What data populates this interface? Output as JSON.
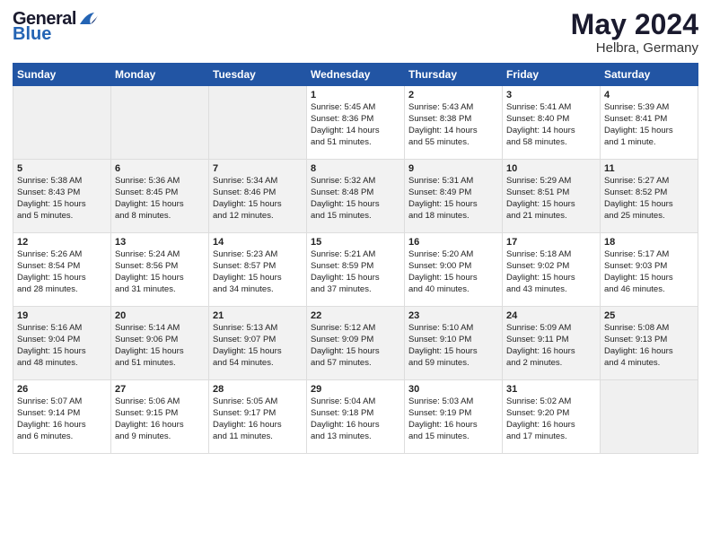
{
  "header": {
    "logo_general": "General",
    "logo_blue": "Blue",
    "month": "May 2024",
    "location": "Helbra, Germany"
  },
  "weekdays": [
    "Sunday",
    "Monday",
    "Tuesday",
    "Wednesday",
    "Thursday",
    "Friday",
    "Saturday"
  ],
  "weeks": [
    [
      {
        "day": "",
        "info": ""
      },
      {
        "day": "",
        "info": ""
      },
      {
        "day": "",
        "info": ""
      },
      {
        "day": "1",
        "info": "Sunrise: 5:45 AM\nSunset: 8:36 PM\nDaylight: 14 hours\nand 51 minutes."
      },
      {
        "day": "2",
        "info": "Sunrise: 5:43 AM\nSunset: 8:38 PM\nDaylight: 14 hours\nand 55 minutes."
      },
      {
        "day": "3",
        "info": "Sunrise: 5:41 AM\nSunset: 8:40 PM\nDaylight: 14 hours\nand 58 minutes."
      },
      {
        "day": "4",
        "info": "Sunrise: 5:39 AM\nSunset: 8:41 PM\nDaylight: 15 hours\nand 1 minute."
      }
    ],
    [
      {
        "day": "5",
        "info": "Sunrise: 5:38 AM\nSunset: 8:43 PM\nDaylight: 15 hours\nand 5 minutes."
      },
      {
        "day": "6",
        "info": "Sunrise: 5:36 AM\nSunset: 8:45 PM\nDaylight: 15 hours\nand 8 minutes."
      },
      {
        "day": "7",
        "info": "Sunrise: 5:34 AM\nSunset: 8:46 PM\nDaylight: 15 hours\nand 12 minutes."
      },
      {
        "day": "8",
        "info": "Sunrise: 5:32 AM\nSunset: 8:48 PM\nDaylight: 15 hours\nand 15 minutes."
      },
      {
        "day": "9",
        "info": "Sunrise: 5:31 AM\nSunset: 8:49 PM\nDaylight: 15 hours\nand 18 minutes."
      },
      {
        "day": "10",
        "info": "Sunrise: 5:29 AM\nSunset: 8:51 PM\nDaylight: 15 hours\nand 21 minutes."
      },
      {
        "day": "11",
        "info": "Sunrise: 5:27 AM\nSunset: 8:52 PM\nDaylight: 15 hours\nand 25 minutes."
      }
    ],
    [
      {
        "day": "12",
        "info": "Sunrise: 5:26 AM\nSunset: 8:54 PM\nDaylight: 15 hours\nand 28 minutes."
      },
      {
        "day": "13",
        "info": "Sunrise: 5:24 AM\nSunset: 8:56 PM\nDaylight: 15 hours\nand 31 minutes."
      },
      {
        "day": "14",
        "info": "Sunrise: 5:23 AM\nSunset: 8:57 PM\nDaylight: 15 hours\nand 34 minutes."
      },
      {
        "day": "15",
        "info": "Sunrise: 5:21 AM\nSunset: 8:59 PM\nDaylight: 15 hours\nand 37 minutes."
      },
      {
        "day": "16",
        "info": "Sunrise: 5:20 AM\nSunset: 9:00 PM\nDaylight: 15 hours\nand 40 minutes."
      },
      {
        "day": "17",
        "info": "Sunrise: 5:18 AM\nSunset: 9:02 PM\nDaylight: 15 hours\nand 43 minutes."
      },
      {
        "day": "18",
        "info": "Sunrise: 5:17 AM\nSunset: 9:03 PM\nDaylight: 15 hours\nand 46 minutes."
      }
    ],
    [
      {
        "day": "19",
        "info": "Sunrise: 5:16 AM\nSunset: 9:04 PM\nDaylight: 15 hours\nand 48 minutes."
      },
      {
        "day": "20",
        "info": "Sunrise: 5:14 AM\nSunset: 9:06 PM\nDaylight: 15 hours\nand 51 minutes."
      },
      {
        "day": "21",
        "info": "Sunrise: 5:13 AM\nSunset: 9:07 PM\nDaylight: 15 hours\nand 54 minutes."
      },
      {
        "day": "22",
        "info": "Sunrise: 5:12 AM\nSunset: 9:09 PM\nDaylight: 15 hours\nand 57 minutes."
      },
      {
        "day": "23",
        "info": "Sunrise: 5:10 AM\nSunset: 9:10 PM\nDaylight: 15 hours\nand 59 minutes."
      },
      {
        "day": "24",
        "info": "Sunrise: 5:09 AM\nSunset: 9:11 PM\nDaylight: 16 hours\nand 2 minutes."
      },
      {
        "day": "25",
        "info": "Sunrise: 5:08 AM\nSunset: 9:13 PM\nDaylight: 16 hours\nand 4 minutes."
      }
    ],
    [
      {
        "day": "26",
        "info": "Sunrise: 5:07 AM\nSunset: 9:14 PM\nDaylight: 16 hours\nand 6 minutes."
      },
      {
        "day": "27",
        "info": "Sunrise: 5:06 AM\nSunset: 9:15 PM\nDaylight: 16 hours\nand 9 minutes."
      },
      {
        "day": "28",
        "info": "Sunrise: 5:05 AM\nSunset: 9:17 PM\nDaylight: 16 hours\nand 11 minutes."
      },
      {
        "day": "29",
        "info": "Sunrise: 5:04 AM\nSunset: 9:18 PM\nDaylight: 16 hours\nand 13 minutes."
      },
      {
        "day": "30",
        "info": "Sunrise: 5:03 AM\nSunset: 9:19 PM\nDaylight: 16 hours\nand 15 minutes."
      },
      {
        "day": "31",
        "info": "Sunrise: 5:02 AM\nSunset: 9:20 PM\nDaylight: 16 hours\nand 17 minutes."
      },
      {
        "day": "",
        "info": ""
      }
    ]
  ]
}
